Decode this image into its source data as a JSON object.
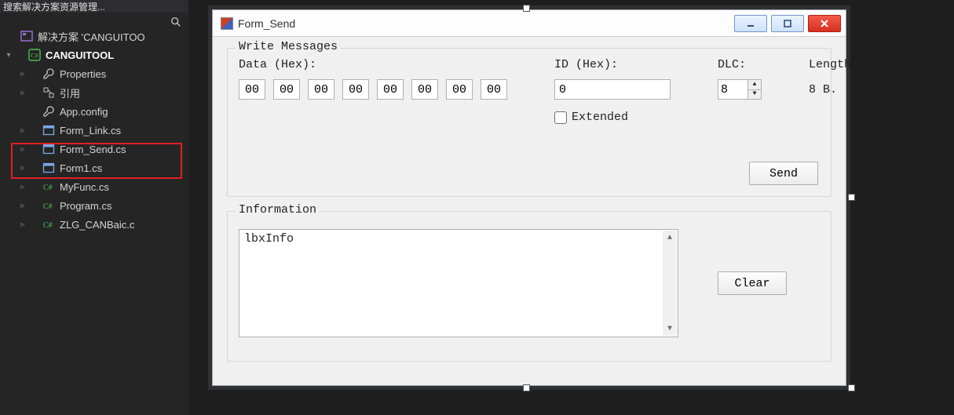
{
  "sidepanel": {
    "top_bar_text": "搜索解决方案资源管理...",
    "solution_row": "解决方案 'CANGUITOO",
    "project_name": "CANGUITOOL",
    "items": [
      {
        "icon": "wrench",
        "label": "Properties",
        "twisty": true
      },
      {
        "icon": "ref",
        "label": "引用",
        "twisty": true
      },
      {
        "icon": "wrench",
        "label": "App.config",
        "twisty": false
      },
      {
        "icon": "form",
        "label": "Form_Link.cs",
        "twisty": true
      },
      {
        "icon": "form",
        "label": "Form_Send.cs",
        "twisty": true
      },
      {
        "icon": "form",
        "label": "Form1.cs",
        "twisty": true
      },
      {
        "icon": "cs",
        "label": "MyFunc.cs",
        "twisty": true
      },
      {
        "icon": "cs",
        "label": "Program.cs",
        "twisty": true
      },
      {
        "icon": "cs",
        "label": "ZLG_CANBaic.c",
        "twisty": true
      }
    ]
  },
  "form": {
    "title": "Form_Send",
    "group_write": "Write Messages",
    "label_data": "Data (Hex):",
    "label_id": "ID (Hex):",
    "label_dlc": "DLC:",
    "label_length": "Length:",
    "data_bytes": [
      "00",
      "00",
      "00",
      "00",
      "00",
      "00",
      "00",
      "00"
    ],
    "id_value": "0",
    "dlc_value": "8",
    "length_text": "8 B.",
    "extended_label": "Extended",
    "send_btn": "Send",
    "group_info": "Information",
    "listbox_placeholder": "lbxInfo",
    "clear_btn": "Clear"
  }
}
